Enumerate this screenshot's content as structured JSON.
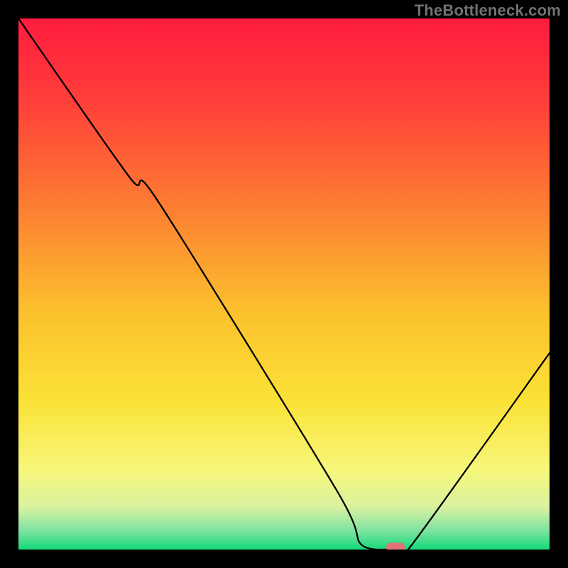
{
  "watermark": "TheBottleneck.com",
  "chart_data": {
    "type": "line",
    "title": "",
    "xlabel": "",
    "ylabel": "",
    "xlim": [
      0,
      100
    ],
    "ylim": [
      0,
      100
    ],
    "series": [
      {
        "name": "curve",
        "x": [
          0,
          21,
          26,
          60,
          64.5,
          70.5,
          71.5,
          74,
          100
        ],
        "values": [
          100,
          70,
          66,
          11,
          1,
          0,
          0,
          0.8,
          37
        ]
      }
    ],
    "marker": {
      "x": 71,
      "y": 0.4
    },
    "gradient_stops": [
      {
        "offset": 0.0,
        "color": "#ff1b3e"
      },
      {
        "offset": 0.15,
        "color": "#ff3d3a"
      },
      {
        "offset": 0.35,
        "color": "#fd7c32"
      },
      {
        "offset": 0.55,
        "color": "#fbc02d"
      },
      {
        "offset": 0.72,
        "color": "#fbe236"
      },
      {
        "offset": 0.85,
        "color": "#f7f77a"
      },
      {
        "offset": 0.92,
        "color": "#d9f2a0"
      },
      {
        "offset": 0.965,
        "color": "#7de3a1"
      },
      {
        "offset": 1.0,
        "color": "#14d97a"
      }
    ]
  }
}
